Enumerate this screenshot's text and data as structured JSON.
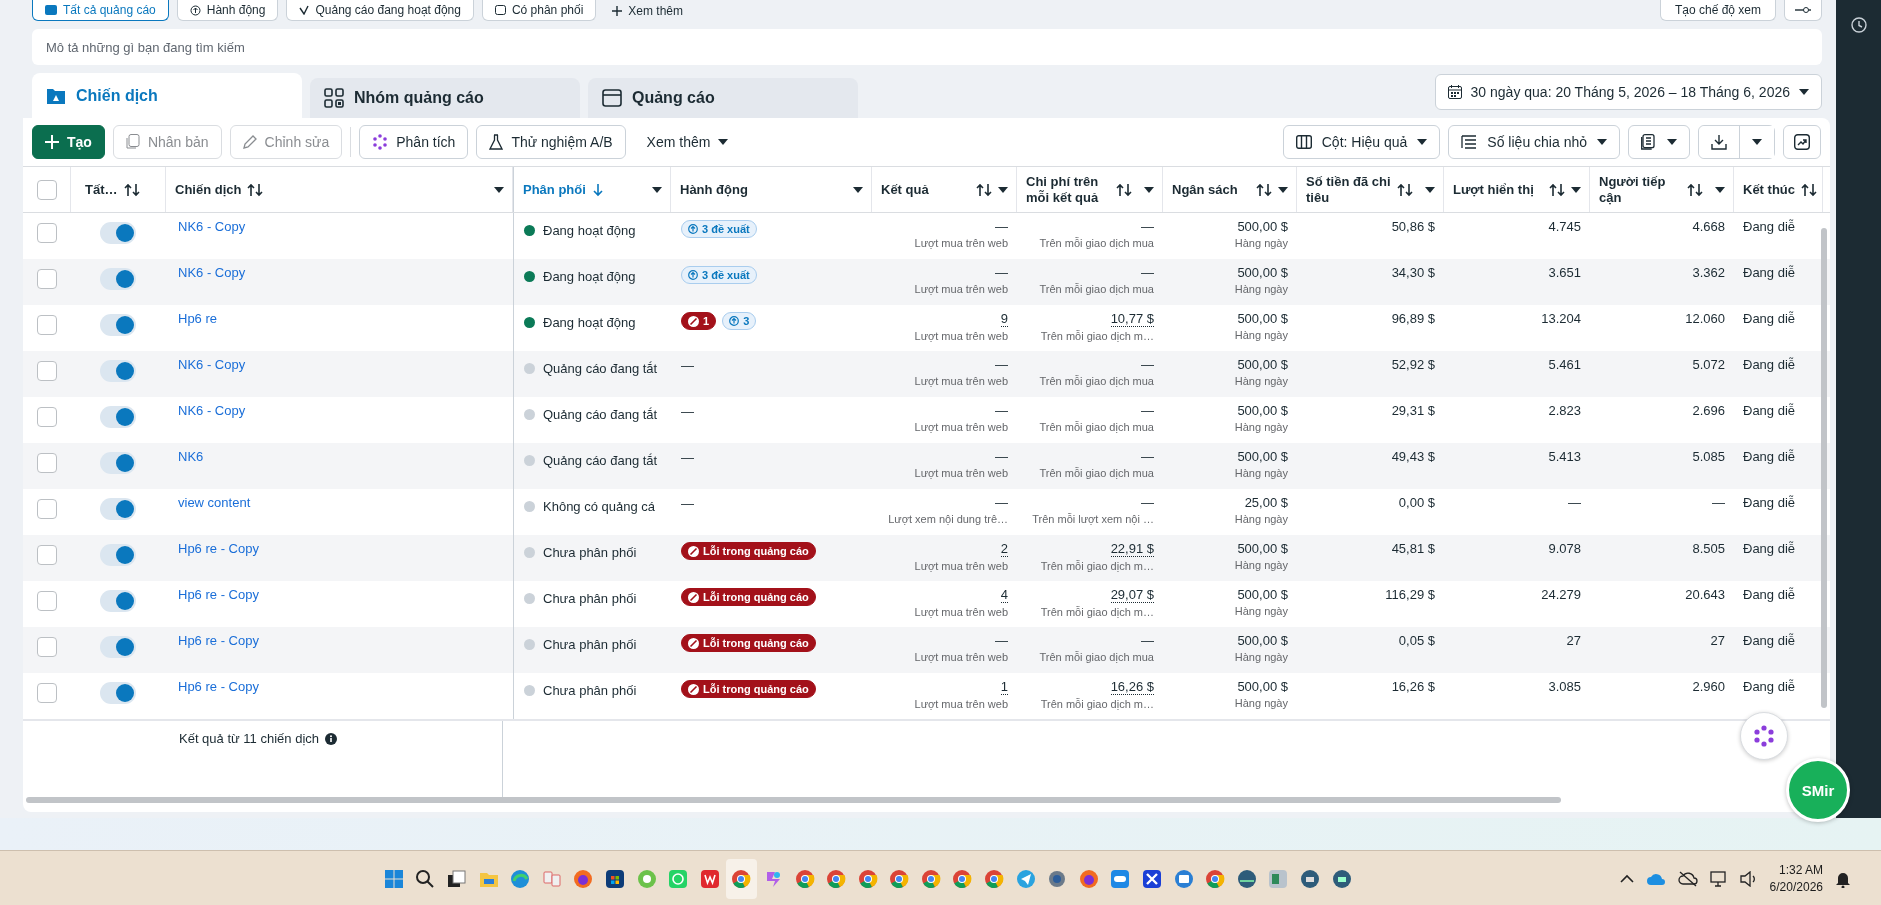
{
  "filter_chips": [
    {
      "label": "Tất cả quảng cáo",
      "selected": true
    },
    {
      "label": "Hành động",
      "selected": false
    },
    {
      "label": "Quảng cáo đang hoạt động",
      "selected": false
    },
    {
      "label": "Có phân phối",
      "selected": false
    }
  ],
  "more_filters": "Xem thêm",
  "create_view": "Tạo chế độ xem",
  "search": {
    "placeholder": "Mô tả những gì bạn đang tìm kiếm"
  },
  "tabs": [
    {
      "label": "Chiến dịch",
      "selected": true
    },
    {
      "label": "Nhóm quảng cáo",
      "selected": false
    },
    {
      "label": "Quảng cáo",
      "selected": false
    }
  ],
  "date_range": "30 ngày qua: 20 Tháng 5, 2026 – 18 Tháng 6, 2026",
  "toolbar": [
    {
      "kind": "create",
      "label": "Tạo",
      "disabled": false
    },
    {
      "kind": "duplicate",
      "label": "Nhân bản",
      "disabled": true
    },
    {
      "kind": "edit",
      "label": "Chỉnh sửa",
      "disabled": true
    },
    {
      "kind": "analyze",
      "label": "Phân tích",
      "disabled": false
    },
    {
      "kind": "ab_test",
      "label": "Thử nghiệm A/B",
      "disabled": false
    },
    {
      "kind": "more",
      "label": "Xem thêm",
      "disabled": false
    }
  ],
  "view_buttons": [
    {
      "kind": "columns",
      "label": "Cột: Hiệu quả"
    },
    {
      "kind": "breakdown",
      "label": "Số liệu chia nhỏ"
    }
  ],
  "header_checkbox": {
    "checked": false
  },
  "columns": [
    {
      "label": "Tất…",
      "sortable": true,
      "sorted": false,
      "menu": false
    },
    {
      "label": "Chiến dịch",
      "sortable": true,
      "sorted": false,
      "menu": true
    },
    {
      "label": "Phân phối",
      "sortable": true,
      "sorted": true,
      "menu": true
    },
    {
      "label": "Hành động",
      "sortable": false,
      "sorted": false,
      "menu": true
    },
    {
      "label": "Kết quả",
      "sortable": true,
      "sorted": false,
      "menu": true
    },
    {
      "label": "Chi phí trên mỗi kết quả",
      "sortable": true,
      "sorted": false,
      "menu": true
    },
    {
      "label": "Ngân sách",
      "sortable": true,
      "sorted": false,
      "menu": true
    },
    {
      "label": "Số tiền đã chi tiêu",
      "sortable": true,
      "sorted": false,
      "menu": true
    },
    {
      "label": "Lượt hiển thị",
      "sortable": true,
      "sorted": false,
      "menu": true
    },
    {
      "label": "Người tiếp cận",
      "sortable": true,
      "sorted": false,
      "menu": true
    },
    {
      "label": "Kết thúc",
      "sortable": true,
      "sorted": false,
      "menu": false
    }
  ],
  "rows": [
    {
      "checked": false,
      "on": true,
      "name": "NK6 - Copy",
      "delivery": {
        "text": "Đang hoạt động",
        "color": "#0b7a57"
      },
      "actions": [
        {
          "kind": "suggestion",
          "text": "3 đề xuất"
        }
      ],
      "results": {
        "value": "—",
        "underlined": false,
        "sub": "Lượt mua trên web"
      },
      "cost": {
        "value": "—",
        "underlined": false,
        "sub": "Trên mỗi giao dịch mua"
      },
      "budget": {
        "value": "500,00 $",
        "sub": "Hàng ngày"
      },
      "spent": "50,86 $",
      "impressions": "4.745",
      "reach": "4.668",
      "end": "Đang diễ"
    },
    {
      "checked": false,
      "on": true,
      "name": "NK6 - Copy",
      "delivery": {
        "text": "Đang hoạt động",
        "color": "#0b7a57"
      },
      "actions": [
        {
          "kind": "suggestion",
          "text": "3 đề xuất"
        }
      ],
      "results": {
        "value": "—",
        "underlined": false,
        "sub": "Lượt mua trên web"
      },
      "cost": {
        "value": "—",
        "underlined": false,
        "sub": "Trên mỗi giao dịch mua"
      },
      "budget": {
        "value": "500,00 $",
        "sub": "Hàng ngày"
      },
      "spent": "34,30 $",
      "impressions": "3.651",
      "reach": "3.362",
      "end": "Đang diễ"
    },
    {
      "checked": false,
      "on": true,
      "name": "Hp6 re",
      "delivery": {
        "text": "Đang hoạt động",
        "color": "#0b7a57"
      },
      "actions": [
        {
          "kind": "error",
          "text": "1"
        },
        {
          "kind": "suggestion",
          "text": "3"
        }
      ],
      "results": {
        "value": "9",
        "underlined": true,
        "sub": "Lượt mua trên web"
      },
      "cost": {
        "value": "10,77 $",
        "underlined": true,
        "sub": "Trên mỗi giao dịch m…"
      },
      "budget": {
        "value": "500,00 $",
        "sub": "Hàng ngày"
      },
      "spent": "96,89 $",
      "impressions": "13.204",
      "reach": "12.060",
      "end": "Đang diễ"
    },
    {
      "checked": false,
      "on": true,
      "name": "NK6 - Copy",
      "delivery": {
        "text": "Quảng cáo đang tắt",
        "color": "#cbd2d9"
      },
      "actions": [
        {
          "kind": "dash",
          "text": "—"
        }
      ],
      "results": {
        "value": "—",
        "underlined": false,
        "sub": "Lượt mua trên web"
      },
      "cost": {
        "value": "—",
        "underlined": false,
        "sub": "Trên mỗi giao dịch mua"
      },
      "budget": {
        "value": "500,00 $",
        "sub": "Hàng ngày"
      },
      "spent": "52,92 $",
      "impressions": "5.461",
      "reach": "5.072",
      "end": "Đang diễ"
    },
    {
      "checked": false,
      "on": true,
      "name": "NK6 - Copy",
      "delivery": {
        "text": "Quảng cáo đang tắt",
        "color": "#cbd2d9"
      },
      "actions": [
        {
          "kind": "dash",
          "text": "—"
        }
      ],
      "results": {
        "value": "—",
        "underlined": false,
        "sub": "Lượt mua trên web"
      },
      "cost": {
        "value": "—",
        "underlined": false,
        "sub": "Trên mỗi giao dịch mua"
      },
      "budget": {
        "value": "500,00 $",
        "sub": "Hàng ngày"
      },
      "spent": "29,31 $",
      "impressions": "2.823",
      "reach": "2.696",
      "end": "Đang diễ"
    },
    {
      "checked": false,
      "on": true,
      "name": "NK6",
      "delivery": {
        "text": "Quảng cáo đang tắt",
        "color": "#cbd2d9"
      },
      "actions": [
        {
          "kind": "dash",
          "text": "—"
        }
      ],
      "results": {
        "value": "—",
        "underlined": false,
        "sub": "Lượt mua trên web"
      },
      "cost": {
        "value": "—",
        "underlined": false,
        "sub": "Trên mỗi giao dịch mua"
      },
      "budget": {
        "value": "500,00 $",
        "sub": "Hàng ngày"
      },
      "spent": "49,43 $",
      "impressions": "5.413",
      "reach": "5.085",
      "end": "Đang diễ"
    },
    {
      "checked": false,
      "on": true,
      "name": "view content",
      "delivery": {
        "text": "Không có quảng cá",
        "color": "#cbd2d9"
      },
      "actions": [
        {
          "kind": "dash",
          "text": "—"
        }
      ],
      "results": {
        "value": "—",
        "underlined": false,
        "sub": "Lượt xem nội dung trê…"
      },
      "cost": {
        "value": "—",
        "underlined": false,
        "sub": "Trên mỗi lượt xem nội …"
      },
      "budget": {
        "value": "25,00 $",
        "sub": "Hàng ngày"
      },
      "spent": "0,00 $",
      "impressions": "—",
      "reach": "—",
      "end": "Đang diễ"
    },
    {
      "checked": false,
      "on": true,
      "name": "Hp6 re - Copy",
      "delivery": {
        "text": "Chưa phân phối",
        "color": "#cbd2d9"
      },
      "actions": [
        {
          "kind": "error",
          "text": "Lỗi trong quảng cáo"
        }
      ],
      "results": {
        "value": "2",
        "underlined": true,
        "sub": "Lượt mua trên web"
      },
      "cost": {
        "value": "22,91 $",
        "underlined": true,
        "sub": "Trên mỗi giao dịch m…"
      },
      "budget": {
        "value": "500,00 $",
        "sub": "Hàng ngày"
      },
      "spent": "45,81 $",
      "impressions": "9.078",
      "reach": "8.505",
      "end": "Đang diễ"
    },
    {
      "checked": false,
      "on": true,
      "name": "Hp6 re - Copy",
      "delivery": {
        "text": "Chưa phân phối",
        "color": "#cbd2d9"
      },
      "actions": [
        {
          "kind": "error",
          "text": "Lỗi trong quảng cáo"
        }
      ],
      "results": {
        "value": "4",
        "underlined": true,
        "sub": "Lượt mua trên web"
      },
      "cost": {
        "value": "29,07 $",
        "underlined": true,
        "sub": "Trên mỗi giao dịch m…"
      },
      "budget": {
        "value": "500,00 $",
        "sub": "Hàng ngày"
      },
      "spent": "116,29 $",
      "impressions": "24.279",
      "reach": "20.643",
      "end": "Đang diễ"
    },
    {
      "checked": false,
      "on": true,
      "name": "Hp6 re - Copy",
      "delivery": {
        "text": "Chưa phân phối",
        "color": "#cbd2d9"
      },
      "actions": [
        {
          "kind": "error",
          "text": "Lỗi trong quảng cáo"
        }
      ],
      "results": {
        "value": "—",
        "underlined": false,
        "sub": "Lượt mua trên web"
      },
      "cost": {
        "value": "—",
        "underlined": false,
        "sub": "Trên mỗi giao dịch mua"
      },
      "budget": {
        "value": "500,00 $",
        "sub": "Hàng ngày"
      },
      "spent": "0,05 $",
      "impressions": "27",
      "reach": "27",
      "end": "Đang diễ"
    },
    {
      "checked": false,
      "on": true,
      "name": "Hp6 re - Copy",
      "delivery": {
        "text": "Chưa phân phối",
        "color": "#cbd2d9"
      },
      "actions": [
        {
          "kind": "error",
          "text": "Lỗi trong quảng cáo"
        }
      ],
      "results": {
        "value": "1",
        "underlined": true,
        "sub": "Lượt mua trên web"
      },
      "cost": {
        "value": "16,26 $",
        "underlined": true,
        "sub": "Trên mỗi giao dịch m…"
      },
      "budget": {
        "value": "500,00 $",
        "sub": "Hàng ngày"
      },
      "spent": "16,26 $",
      "impressions": "3.085",
      "reach": "2.960",
      "end": "Đang diễ"
    }
  ],
  "footer": "Kết quả từ 11 chiến dịch",
  "assistant_button": "SMir",
  "taskbar": {
    "time": "1:32 AM",
    "date": "6/20/2026"
  }
}
